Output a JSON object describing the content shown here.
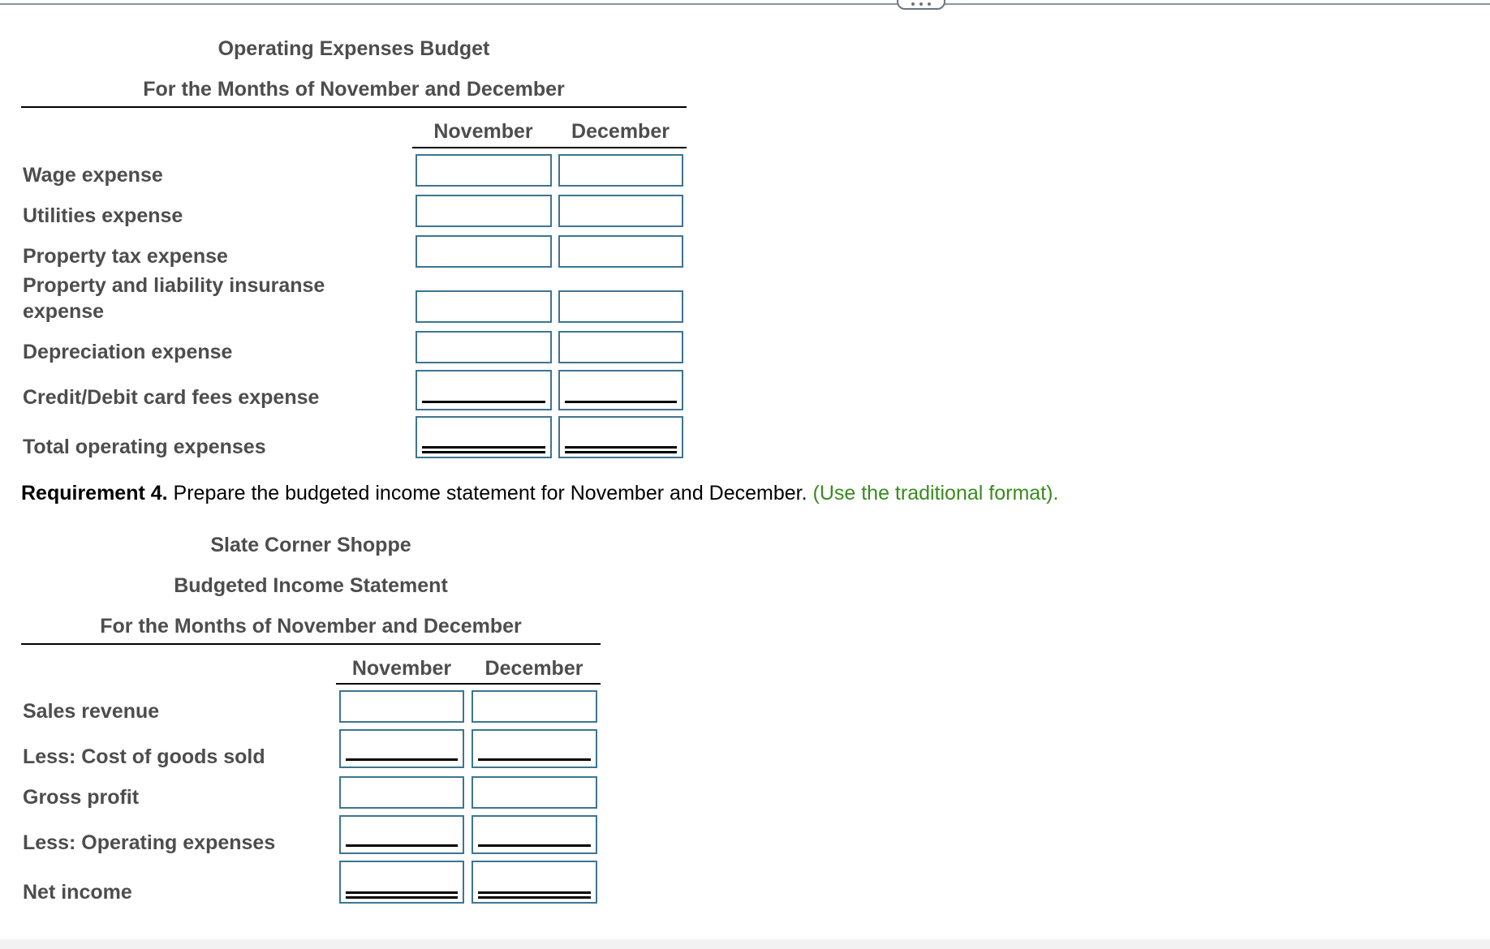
{
  "toolbar": {
    "more_button_icon": "more-horizontal-icon"
  },
  "operating_budget": {
    "title": "Operating Expenses Budget",
    "subtitle": "For the Months of November and December",
    "columns": [
      "November",
      "December"
    ],
    "rows": [
      {
        "label": "Wage expense",
        "november": "",
        "december": "",
        "rule": "none"
      },
      {
        "label": "Utilities expense",
        "november": "",
        "december": "",
        "rule": "none"
      },
      {
        "label": "Property tax expense",
        "november": "",
        "december": "",
        "rule": "none"
      },
      {
        "label_line1": "Property and liability insuranse",
        "label_line2": "expense",
        "november": "",
        "december": "",
        "rule": "none"
      },
      {
        "label": "Depreciation expense",
        "november": "",
        "december": "",
        "rule": "none"
      },
      {
        "label": "Credit/Debit card fees expense",
        "november": "",
        "december": "",
        "rule": "single"
      },
      {
        "label": "Total operating expenses",
        "november": "",
        "december": "",
        "rule": "double"
      }
    ]
  },
  "requirement": {
    "label": "Requirement 4.",
    "text": " Prepare the budgeted income statement for November and December. ",
    "hint": "(Use the traditional format)."
  },
  "income_statement": {
    "company": "Slate Corner Shoppe",
    "title": "Budgeted Income Statement",
    "subtitle": "For the Months of November and December",
    "columns": [
      "November",
      "December"
    ],
    "rows": [
      {
        "label": "Sales revenue",
        "november": "",
        "december": "",
        "rule": "none"
      },
      {
        "label": "Less: Cost of goods sold",
        "november": "",
        "december": "",
        "rule": "single"
      },
      {
        "label": "Gross profit",
        "november": "",
        "december": "",
        "rule": "none"
      },
      {
        "label": "Less: Operating expenses",
        "november": "",
        "december": "",
        "rule": "single"
      },
      {
        "label": "Net income",
        "november": "",
        "december": "",
        "rule": "double"
      }
    ]
  },
  "colors": {
    "input_border": "#3c7592",
    "hint_text": "#3a8a1e",
    "heading_text": "#4d4d4d"
  }
}
